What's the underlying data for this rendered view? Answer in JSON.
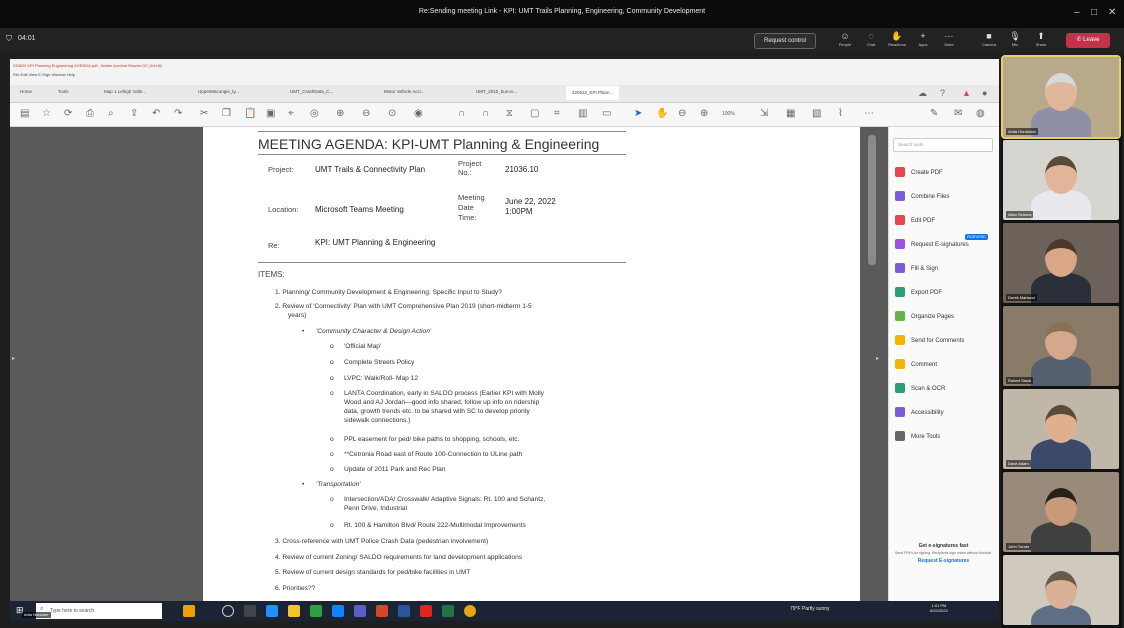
{
  "window": {
    "title": "Re:Sending meeting Link - KPI: UMT Trails Planning, Engineering, Community Development",
    "controls": [
      "–",
      "□",
      "✕"
    ]
  },
  "meeting": {
    "timer": "04:01",
    "request_control": "Request control",
    "buttons": [
      "People",
      "Chat",
      "Reactions",
      "Apps",
      "More",
      "Camera",
      "Mic",
      "Share"
    ],
    "leave": "Leave"
  },
  "acrobat": {
    "file": "220622 KPI Planning Engineering AGENDA.pdf - Adobe Acrobat Reader DC (64-bit)",
    "menus": "File  Edit  View  E-Sign  Window  Help",
    "tabs": [
      "Home",
      "Tools",
      "Map 1 Lehigh Valle...",
      "UpperMacungie_ty...",
      "UMT_CrashData_C...",
      "Motor Vehicle Acci...",
      "UMT_2010_bus-ro...",
      "220622_KPI Plann..."
    ],
    "zoom": "100%",
    "search_placeholder": "Search tools",
    "tools": [
      {
        "label": "Create PDF",
        "color": "#e34850"
      },
      {
        "label": "Combine Files",
        "color": "#7b5cd6"
      },
      {
        "label": "Edit PDF",
        "color": "#e34850"
      },
      {
        "label": "Request E-signatures",
        "color": "#9b51e0"
      },
      {
        "label": "Fill & Sign",
        "color": "#7b5cd6"
      },
      {
        "label": "Export PDF",
        "color": "#2d9d78"
      },
      {
        "label": "Organize Pages",
        "color": "#63b34a"
      },
      {
        "label": "Send for Comments",
        "color": "#f5b400"
      },
      {
        "label": "Comment",
        "color": "#f5b400"
      },
      {
        "label": "Scan & OCR",
        "color": "#2d9d78"
      },
      {
        "label": "Accessibility",
        "color": "#7b5cd6"
      },
      {
        "label": "More Tools",
        "color": "#666"
      }
    ],
    "featured": "FEATURED",
    "promo_title": "Get e-signatures fast",
    "promo_text": "Send PDFs for signing. Recipients sign online without Acrobat.",
    "promo_link": "Request E-signatures"
  },
  "doc": {
    "title": "MEETING AGENDA:  KPI-UMT Planning & Engineering",
    "project_label": "Project:",
    "project_value": "UMT Trails & Connectivity Plan",
    "project_no_label": "Project No.:",
    "project_no": "21036.10",
    "location_label": "Location:",
    "location_value": "Microsoft Teams Meeting",
    "date_label": "Meeting Date Time:",
    "date_value": "June 22, 2022",
    "time_value": "1:00PM",
    "re_label": "Re:",
    "re_value": "KPI: UMT Planning & Engineering",
    "items_label": "ITEMS:",
    "i1": "1.   Planning/ Community Development & Engineering; Specific Input to Study?",
    "i2": "2.   Review of 'Connectivity' Plan with UMT Comprehensive Plan 2019 (short-midterm 1-5",
    "i2b": "years)",
    "b1": "'Community Character & Design Action'",
    "s1": "'Official Map'",
    "s2": "Complete Streets Policy",
    "s3": "LVPC: Walk/Roll- Map 12",
    "s4a": "LANTA Coordination, early in SALDO process (Earlier KPI with Molly",
    "s4b": "Wood and AJ Jordan—good info shared, follow up info on ridership",
    "s4c": "data, growth trends etc. to be shared with SC to develop priority",
    "s4d": "sidewalk connections.)",
    "s5": "PPL easement for ped/ bike paths to shopping, schools, etc.",
    "s6": "**Cetronia Road east of Route 100-Connection to ULine path",
    "s7": "Update of 2011 Park and Rec Plan",
    "b2": "'Transportation'",
    "t1a": "Intersection/ADA/ Crosswalk/ Adaptive Signals:  Rt. 100 and Schantz,",
    "t1b": "Penn Drive, Industrial",
    "t2": "Rt. 100 & Hamilton Blvd/ Route 222-Multimodal Improvements",
    "i3": "3.   Cross-reference with UMT Police Crash Data (pedestrian involvement)",
    "i4": "4.   Review of current Zoning/ SALDO requirements for land development applications",
    "i5": "5.   Review of current design standards for ped/bike facilities in UMT",
    "i6": "6.   Priorities??"
  },
  "taskbar": {
    "search": "Type here to search",
    "weather": "79°F  Partly sunny",
    "time": "1:01 PM",
    "date": "6/22/2022",
    "user": "Anita Hunsicker"
  },
  "participants": [
    {
      "name": "Anita Hunsicker",
      "bg": "#b8a98a",
      "skin": "#e0b79a",
      "hair": "#d8d8d8",
      "shirt": "#8f8fa8"
    },
    {
      "name": "Allan Simons",
      "bg": "#d7d5cf",
      "skin": "#e2b49a",
      "hair": "#5a4a3a",
      "shirt": "#e8e8ee"
    },
    {
      "name": "Derek Martucci",
      "bg": "#6d625a",
      "skin": "#d9a688",
      "hair": "#4a3a2e",
      "shirt": "#2b2f3a"
    },
    {
      "name": "Robert Stock",
      "bg": "#8a7a68",
      "skin": "#d5a78c",
      "hair": "#8a7050",
      "shirt": "#556070"
    },
    {
      "name": "Dave Adam",
      "bg": "#bfb8a8",
      "skin": "#dfb090",
      "hair": "#5a4a3a",
      "shirt": "#3c4a6a"
    },
    {
      "name": "John Turner",
      "bg": "#9a8a7a",
      "skin": "#c99a7a",
      "hair": "#2a2018",
      "shirt": "#404040"
    },
    {
      "name": "",
      "bg": "#cfc9be",
      "skin": "#dab096",
      "hair": "#6a5a4a",
      "shirt": "#5d6e85"
    }
  ]
}
